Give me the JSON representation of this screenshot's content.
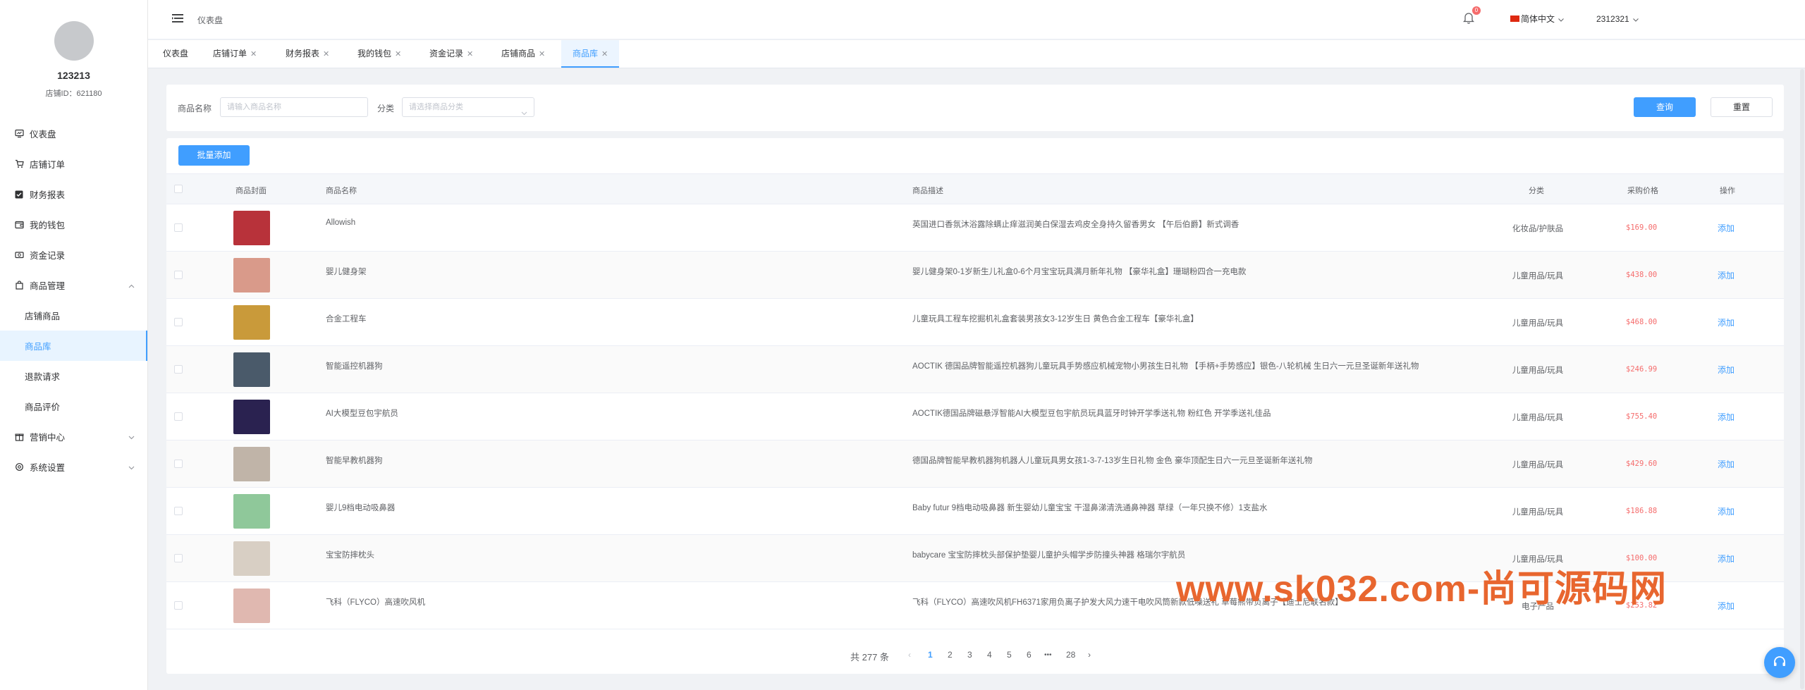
{
  "sidebar": {
    "profile_name": "123213",
    "shop_id": "店铺ID：621180",
    "menu": [
      {
        "label": "仪表盘",
        "icon": "dashboard-icon"
      },
      {
        "label": "店铺订单",
        "icon": "cart-icon"
      },
      {
        "label": "财务报表",
        "icon": "checkbox-icon"
      },
      {
        "label": "我的钱包",
        "icon": "wallet-icon"
      },
      {
        "label": "资金记录",
        "icon": "money-icon"
      },
      {
        "label": "商品管理",
        "icon": "goods-icon"
      }
    ],
    "submenu": [
      {
        "label": "店铺商品"
      },
      {
        "label": "商品库"
      },
      {
        "label": "退款请求"
      },
      {
        "label": "商品评价"
      }
    ],
    "menu_bottom": [
      {
        "label": "营销中心",
        "icon": "gift-icon"
      },
      {
        "label": "系统设置",
        "icon": "settings-icon"
      }
    ]
  },
  "topbar": {
    "breadcrumb": "仪表盘",
    "bell_count": "0",
    "language": "简体中文",
    "username": "2312321"
  },
  "tabs": [
    "仪表盘",
    "店铺订单",
    "财务报表",
    "我的钱包",
    "资金记录",
    "店铺商品",
    "商品库"
  ],
  "search": {
    "name_label": "商品名称",
    "name_placeholder": "请输入商品名称",
    "category_label": "分类",
    "category_placeholder": "请选择商品分类",
    "query_button": "查询",
    "reset_button": "重置"
  },
  "table": {
    "batch_add_button": "批量添加",
    "headers": {
      "cover": "商品封面",
      "name": "商品名称",
      "description": "商品描述",
      "category": "分类",
      "price": "采购价格",
      "action": "操作"
    },
    "rows": [
      {
        "name": "Allowish",
        "desc": "英国进口香氛沐浴露除螨止痒滋润美白保湿去鸡皮全身持久留香男女 【午后伯爵】新式调香",
        "category": "化妆品/护肤品",
        "price": "$169.00",
        "action": "添加",
        "thumb_color": "#b8323a"
      },
      {
        "name": "婴儿健身架",
        "desc": "婴儿健身架0-1岁新生儿礼盒0-6个月宝宝玩具满月新年礼物 【豪华礼盒】珊瑚粉四合一充电款",
        "category": "儿童用品/玩具",
        "price": "$438.00",
        "action": "添加",
        "thumb_color": "#d99a8a"
      },
      {
        "name": "合金工程车",
        "desc": "儿童玩具工程车挖掘机礼盒套装男孩女3-12岁生日 黄色合金工程车【豪华礼盒】",
        "category": "儿童用品/玩具",
        "price": "$468.00",
        "action": "添加",
        "thumb_color": "#c99a3a"
      },
      {
        "name": "智能遥控机器狗",
        "desc": "AOCTIK 德国品牌智能遥控机器狗儿童玩具手势感应机械宠物小男孩生日礼物 【手柄+手势感应】银色-八轮机械 生日六一元旦圣诞新年送礼物",
        "category": "儿童用品/玩具",
        "price": "$246.99",
        "action": "添加",
        "thumb_color": "#4a5a6a"
      },
      {
        "name": "AI大模型豆包宇航员",
        "desc": "AOCTIK德国品牌磁悬浮智能AI大模型豆包宇航员玩具蓝牙时钟开学季送礼物 粉红色 开学季送礼佳品",
        "category": "儿童用品/玩具",
        "price": "$755.40",
        "action": "添加",
        "thumb_color": "#2a2250"
      },
      {
        "name": "智能早教机器狗",
        "desc": "德国品牌智能早教机器狗机器人儿童玩具男女孩1-3-7-13岁生日礼物 金色 豪华顶配生日六一元旦圣诞新年送礼物",
        "category": "儿童用品/玩具",
        "price": "$429.60",
        "action": "添加",
        "thumb_color": "#c0b4a8"
      },
      {
        "name": "婴儿9档电动吸鼻器",
        "desc": "Baby futur 9档电动吸鼻器 新生婴幼儿童宝宝 干湿鼻涕清洗通鼻神器 草绿（一年只换不修）1支盐水",
        "category": "儿童用品/玩具",
        "price": "$186.88",
        "action": "添加",
        "thumb_color": "#8fc89a"
      },
      {
        "name": "宝宝防摔枕头",
        "desc": "babycare 宝宝防摔枕头部保护垫婴儿童护头帽学步防撞头神器 格瑞尔宇航员",
        "category": "儿童用品/玩具",
        "price": "$100.00",
        "action": "添加",
        "thumb_color": "#d8cfc4"
      },
      {
        "name": "飞科（FLYCO）高速吹风机",
        "desc": "飞科（FLYCO）高速吹风机FH6371家用负离子护发大风力速干电吹风筒新款低噪送礼 草莓熊带负离子【迪士尼联名款】",
        "category": "电子产品",
        "price": "$253.82",
        "action": "添加",
        "thumb_color": "#e0b8b0"
      }
    ]
  },
  "pagination": {
    "total": "共 277 条",
    "pages": [
      "1",
      "2",
      "3",
      "4",
      "5",
      "6"
    ],
    "ellipsis": "•••",
    "last": "28"
  },
  "watermark": "www.sk032.com-尚可源码网",
  "colors": {
    "primary": "#409eff",
    "price": "#f56c6c",
    "watermark": "#e8662f"
  }
}
